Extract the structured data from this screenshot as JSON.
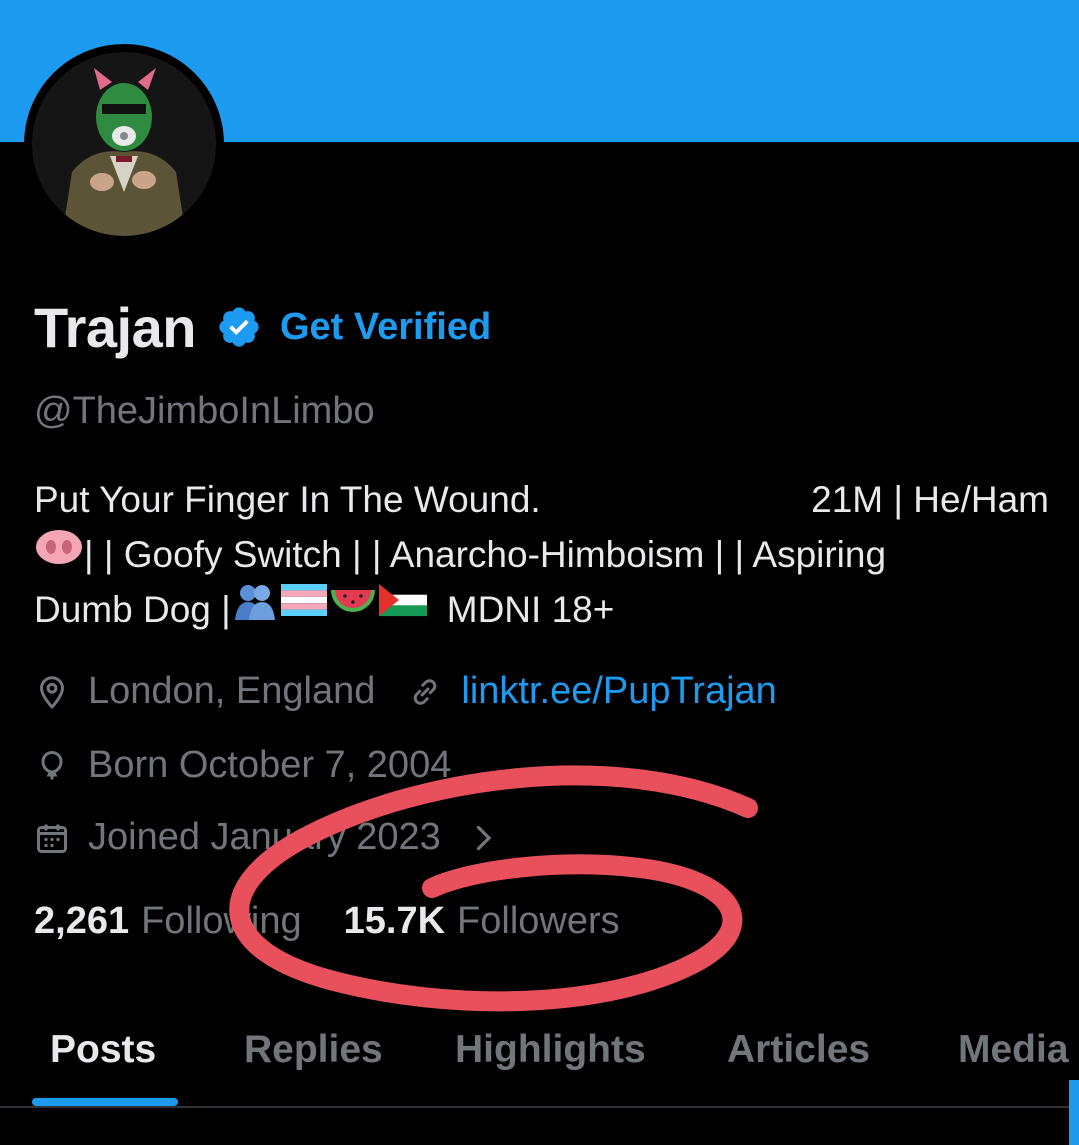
{
  "profile": {
    "name": "Trajan",
    "verified_icon": "verified-badge-icon",
    "get_verified": "Get Verified",
    "handle": "@TheJimboInLimbo"
  },
  "bio": {
    "line1_left": "Put Your Finger In The Wound.",
    "line1_right": "21M  | He/Ham",
    "line2": " |  | Goofy Switch | | Anarcho-Himboism |  | Aspiring",
    "line3_left": "Dumb Dog | ",
    "line3_right": "MDNI 18+"
  },
  "meta": {
    "location": "London, England",
    "link": "linktr.ee/PupTrajan",
    "born": "Born October 7, 2004",
    "joined": "Joined January 2023"
  },
  "stats": {
    "following_count": "2,261",
    "following_label": "Following",
    "followers_count": "15.7K",
    "followers_label": "Followers"
  },
  "tabs": [
    {
      "label": "Posts"
    },
    {
      "label": "Replies"
    },
    {
      "label": "Highlights"
    },
    {
      "label": "Articles"
    },
    {
      "label": "Media"
    }
  ],
  "colors": {
    "accent": "#1d9bf0",
    "annotation": "#e8505b"
  },
  "icons": [
    "location-pin-icon",
    "link-icon",
    "balloon-icon",
    "calendar-icon",
    "chevron-right-icon"
  ]
}
